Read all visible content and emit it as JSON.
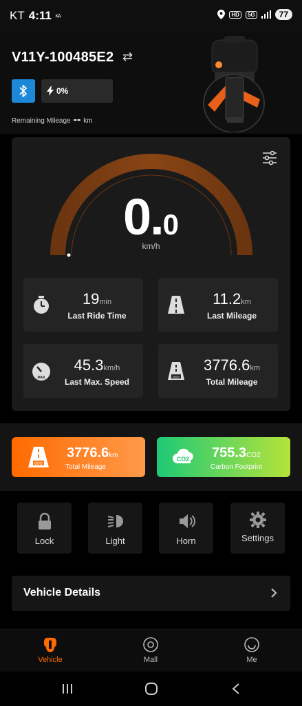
{
  "status_bar": {
    "carrier": "KT",
    "time": "4:11",
    "carrier_extra": "ᴷᴬ",
    "hd": "HD",
    "network": "5G",
    "battery": "77"
  },
  "header": {
    "vehicle_name": "V11Y-100485E2",
    "charge_percent": "0%",
    "remaining_label": "Remaining Mileage",
    "remaining_value": "--",
    "remaining_unit": "km"
  },
  "speed": {
    "integer": "0.",
    "decimal": "0",
    "unit": "km/h",
    "level": 0
  },
  "stats": [
    {
      "value": "19",
      "unit": "min",
      "label": "Last Ride Time"
    },
    {
      "value": "11.2",
      "unit": "km",
      "label": "Last Mileage"
    },
    {
      "value": "45.3",
      "unit": "km/h",
      "label": "Last Max. Speed"
    },
    {
      "value": "3776.6",
      "unit": "km",
      "label": "Total Mileage"
    }
  ],
  "summary": {
    "total": {
      "value": "3776.6",
      "unit": "km",
      "label": "Total Mileage"
    },
    "carbon": {
      "value": "755.3",
      "unit": "CO2",
      "label": "Carbon Footprint"
    }
  },
  "controls": [
    {
      "label": "Lock",
      "icon": "lock-icon"
    },
    {
      "label": "Light",
      "icon": "light-icon"
    },
    {
      "label": "Horn",
      "icon": "horn-icon"
    },
    {
      "label": "Settings",
      "icon": "gear-icon"
    }
  ],
  "vehicle_details_label": "Vehicle Details",
  "bottom_nav": [
    {
      "label": "Vehicle",
      "active": true
    },
    {
      "label": "Mall",
      "active": false
    },
    {
      "label": "Me",
      "active": false
    }
  ],
  "colors": {
    "accent": "#ff6a00",
    "bluetooth": "#1e88d8",
    "carbon_green": "#1ec977"
  }
}
